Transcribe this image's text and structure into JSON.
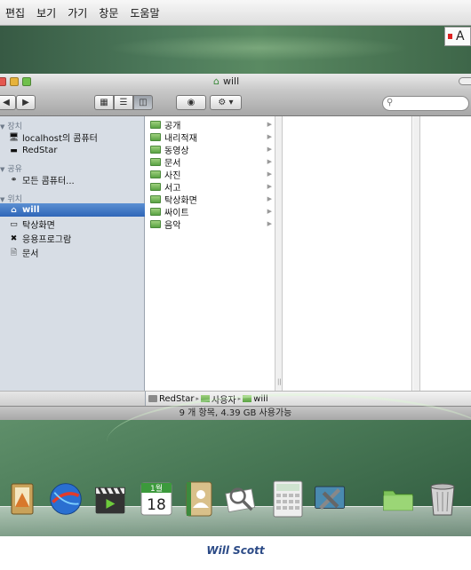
{
  "menubar": {
    "items": [
      "편집",
      "보기",
      "가기",
      "창문",
      "도움말"
    ]
  },
  "ime": {
    "letter": "A"
  },
  "window": {
    "title": "will",
    "search": {
      "placeholder": ""
    }
  },
  "sidebar": {
    "sections": [
      {
        "title": "장치",
        "items": [
          {
            "label": "localhost의 콤퓨터",
            "icon": "network-computer-icon"
          },
          {
            "label": "RedStar",
            "icon": "disk-icon"
          }
        ]
      },
      {
        "title": "공유",
        "items": [
          {
            "label": "모든 콤퓨터...",
            "icon": "globe-icon"
          }
        ]
      },
      {
        "title": "위치",
        "items": [
          {
            "label": "will",
            "icon": "home-icon",
            "selected": true
          },
          {
            "label": "탁상화면",
            "icon": "desktop-folder-icon"
          },
          {
            "label": "응용프로그람",
            "icon": "applications-icon"
          },
          {
            "label": "문서",
            "icon": "document-icon"
          }
        ]
      }
    ]
  },
  "columns": {
    "first": [
      "공개",
      "내리적재",
      "동영상",
      "문서",
      "사진",
      "서고",
      "탁상화면",
      "싸이트",
      "음악"
    ]
  },
  "pathbar": {
    "segments": [
      "RedStar",
      "사용자",
      "will"
    ]
  },
  "status": {
    "text": "9 개 항목, 4.39 GB 사용가능"
  },
  "dock": {
    "items": [
      "preview-icon",
      "browser-globe-icon",
      "video-clapper-icon",
      "calendar-icon",
      "address-book-icon",
      "image-viewer-icon",
      "calculator-icon",
      "system-preferences-icon",
      "folder-icon",
      "trash-icon"
    ],
    "calendar": {
      "month": "1월",
      "day": "18"
    }
  },
  "caption": "Will Scott",
  "colors": {
    "selection": "#3a72c2",
    "folder": "#6db24f",
    "caption": "#2b4a86"
  }
}
